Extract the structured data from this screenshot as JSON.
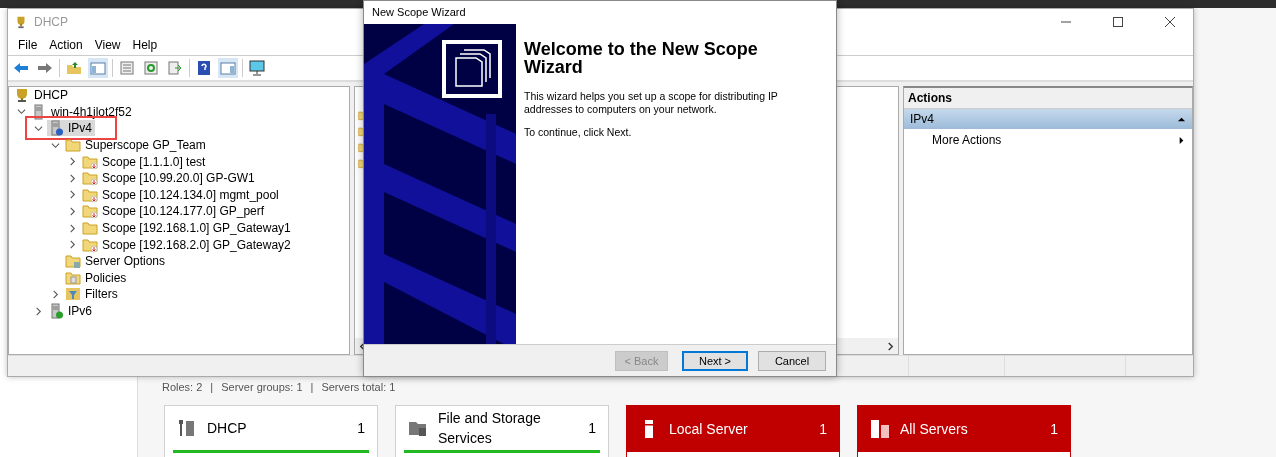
{
  "dhcp_window": {
    "title": "DHCP",
    "menu": [
      "File",
      "Action",
      "View",
      "Help"
    ],
    "tree": [
      {
        "label": "DHCP",
        "kind": "root",
        "selected": false,
        "children": [
          {
            "label": "win-4h1jlot2f52",
            "kind": "server",
            "expanded": true,
            "selected": false,
            "children": [
              {
                "label": "IPv4",
                "kind": "ipv4",
                "expanded": true,
                "selected": true,
                "highlighted": true,
                "children": [
                  {
                    "label": "Superscope GP_Team",
                    "kind": "folder",
                    "expanded": true,
                    "selected": false,
                    "children": [
                      {
                        "label": "Scope [1.1.1.0] test",
                        "kind": "scope",
                        "inactive": true,
                        "expanded": false,
                        "selected": false
                      },
                      {
                        "label": "Scope [10.99.20.0] GP-GW1",
                        "kind": "scope",
                        "inactive": true,
                        "expanded": false,
                        "selected": false
                      },
                      {
                        "label": "Scope [10.124.134.0] mgmt_pool",
                        "kind": "scope",
                        "inactive": true,
                        "expanded": false,
                        "selected": false
                      },
                      {
                        "label": "Scope [10.124.177.0] GP_perf",
                        "kind": "scope",
                        "inactive": true,
                        "expanded": false,
                        "selected": false
                      },
                      {
                        "label": "Scope [192.168.1.0] GP_Gateway1",
                        "kind": "scope",
                        "inactive": false,
                        "expanded": false,
                        "selected": false
                      },
                      {
                        "label": "Scope [192.168.2.0] GP_Gateway2",
                        "kind": "scope",
                        "inactive": true,
                        "expanded": false,
                        "selected": false
                      }
                    ]
                  },
                  {
                    "label": "Server Options",
                    "kind": "options",
                    "selected": false
                  },
                  {
                    "label": "Policies",
                    "kind": "policies",
                    "selected": false
                  },
                  {
                    "label": "Filters",
                    "kind": "filter",
                    "expanded": false,
                    "selected": false
                  }
                ]
              },
              {
                "label": "IPv6",
                "kind": "ipv6",
                "expanded": false,
                "selected": false
              }
            ]
          }
        ]
      }
    ],
    "actions": {
      "title": "Actions",
      "group": "IPv4",
      "items": [
        "More Actions"
      ]
    }
  },
  "wizard": {
    "title": "New Scope Wizard",
    "heading": "Welcome to the New Scope Wizard",
    "paragraphs": [
      "This wizard helps you set up a scope for distributing IP addresses to computers on your network.",
      "To continue, click Next."
    ],
    "buttons": [
      {
        "label": "< Back",
        "disabled": true,
        "default": false
      },
      {
        "label": "Next >",
        "disabled": false,
        "default": true
      },
      {
        "label": "Cancel",
        "disabled": false,
        "default": false
      }
    ]
  },
  "dashboard": {
    "summary": [
      "Roles: 2",
      "|",
      "Server groups: 1",
      "|",
      "Servers total: 1"
    ],
    "tiles": [
      {
        "title": "DHCP",
        "count": "1",
        "kind": "role",
        "alert": false
      },
      {
        "title": "File and Storage Services",
        "count": "1",
        "kind": "storage",
        "alert": false
      },
      {
        "title": "Local Server",
        "count": "1",
        "kind": "server",
        "alert": true
      },
      {
        "title": "All Servers",
        "count": "1",
        "kind": "servers",
        "alert": true
      }
    ]
  }
}
